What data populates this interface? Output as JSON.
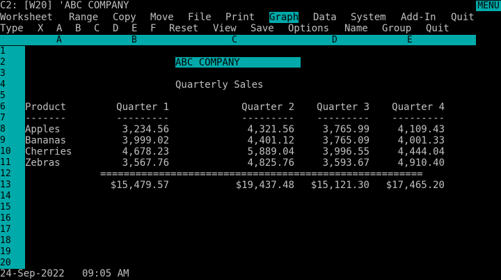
{
  "status_line": "C2: [W20] 'ABC COMPANY",
  "mode_indicator": "MENU",
  "main_menu": {
    "items": [
      "Worksheet",
      "Range",
      "Copy",
      "Move",
      "File",
      "Print",
      "Graph",
      "Data",
      "System",
      "Add-In",
      "Quit"
    ],
    "active": "Graph"
  },
  "sub_menu": {
    "items": [
      "Type",
      "X",
      "A",
      "B",
      "C",
      "D",
      "E",
      "F",
      "Reset",
      "View",
      "Save",
      "Options",
      "Name",
      "Group",
      "Quit"
    ]
  },
  "columns": [
    "A",
    "B",
    "C",
    "D",
    "E"
  ],
  "rows": [
    "1",
    "2",
    "3",
    "4",
    "5",
    "6",
    "7",
    "8",
    "9",
    "10",
    "11",
    "12",
    "13",
    "14",
    "15",
    "16",
    "17",
    "18",
    "19",
    "20"
  ],
  "sheet": {
    "company": "ABC COMPANY",
    "subtitle": "Quarterly Sales",
    "headers": [
      "Product",
      "Quarter 1",
      "Quarter 2",
      "Quarter 3",
      "Quarter 4"
    ],
    "dashes": [
      "-------",
      "---------",
      "---------",
      "---------",
      "---------"
    ],
    "data_rows": [
      {
        "product": "Apples",
        "values": [
          "3,234.56",
          "4,321.56",
          "3,765.99",
          "4,109.43"
        ]
      },
      {
        "product": "Bananas",
        "values": [
          "3,999.02",
          "4,401.12",
          "3,765.09",
          "4,001.33"
        ]
      },
      {
        "product": "Cherries",
        "values": [
          "4,678.23",
          "5,889.04",
          "3,996.55",
          "4,444.04"
        ]
      },
      {
        "product": "Zebras",
        "values": [
          "3,567.76",
          "4,825.76",
          "3,593.67",
          "4,910.40"
        ]
      }
    ],
    "separator": "=======================================================",
    "totals": [
      "$15,479.57",
      "$19,437.48",
      "$15,121.30",
      "$17,465.20"
    ]
  },
  "date_time": "24-Sep-2022   09:05 AM",
  "colors": {
    "background": "#000000",
    "text": "#c0c0c0",
    "accent": "#00aaaa",
    "accent_text": "#000000"
  }
}
